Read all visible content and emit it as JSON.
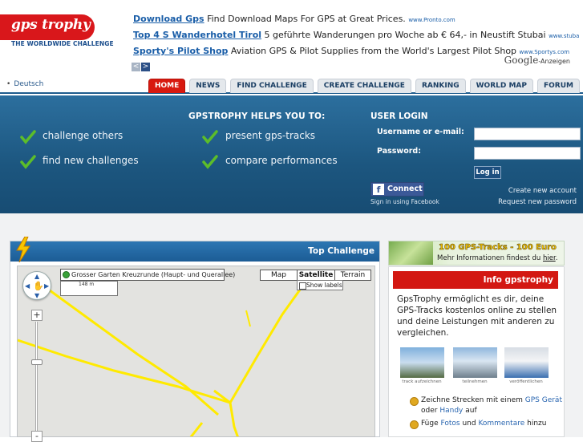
{
  "logo": {
    "name": "gps trophy",
    "tagline": "THE WORLDWIDE CHALLENGE"
  },
  "ads": [
    {
      "title": "Download Gps",
      "text": "Find Download Maps For GPS at Great Prices.",
      "url": "www.Pronto.com"
    },
    {
      "title": "Top 4 S Wanderhotel Tirol",
      "text": "5 geführte Wanderungen pro Woche ab € 64,- in Neustift Stubai",
      "url": "www.stubaierhof.eu/wand..."
    },
    {
      "title": "Sporty's Pilot Shop",
      "text": "Aviation GPS & Pilot Supplies from the World's Largest Pilot Shop",
      "url": "www.Sportys.com"
    }
  ],
  "ad_nav": {
    "prev": "<",
    "next": ">"
  },
  "google_ads": {
    "brand": "Google",
    "label": "-Anzeigen"
  },
  "nav": {
    "language": "Deutsch",
    "tabs": [
      "HOME",
      "NEWS",
      "FIND CHALLENGE",
      "CREATE CHALLENGE",
      "RANKING",
      "WORLD MAP",
      "FORUM"
    ]
  },
  "hero": {
    "heading": "GPSTROPHY HELPS YOU TO:",
    "features_left": [
      "challenge others",
      "find new challenges"
    ],
    "features_right": [
      "present gps-tracks",
      "compare performances"
    ],
    "check_color": "#5cbd2a"
  },
  "login": {
    "title": "USER LOGIN",
    "username_label": "Username or e-mail:",
    "password_label": "Password:",
    "button": "Log in",
    "fb_connect": "Connect",
    "fb_note": "Sign in using Facebook",
    "create_account": "Create new account",
    "request_password": "Request new password"
  },
  "challenge": {
    "title": "Top Challenge",
    "map_label": "Grosser Garten Kreuzrunde (Haupt- und Querallee)",
    "map_info_value": "148 m",
    "map_types": [
      "Map",
      "Satellite",
      "Terrain"
    ],
    "selected_map_type": "Satellite",
    "show_labels": "Show labels",
    "zoom_in": "+",
    "zoom_out": "-"
  },
  "banner": {
    "title": "100 GPS-Tracks - 100 Euro",
    "sub_prefix": "Mehr Informationen findest du ",
    "sub_link": "hier",
    "sub_suffix": "."
  },
  "info": {
    "title": "Info gpstrophy",
    "text": "GpsTrophy ermöglicht es dir, deine GPS-Tracks kostenlos online zu stellen und deine Leistungen mit anderen zu vergleichen.",
    "thumbs": [
      "track aufzeichnen",
      "teilnehmen",
      "veröffentlichen"
    ],
    "bullets": [
      {
        "a": "Zeichne Strecken mit einem ",
        "link1": "GPS Gerät",
        "b": " oder ",
        "link2": "Handy",
        "c": " auf"
      },
      {
        "a": "Füge ",
        "link1": "Fotos",
        "b": " und ",
        "link2": "Kommentare",
        "c": " hinzu"
      }
    ]
  },
  "colors": {
    "brand_red": "#d9171b",
    "hero_blue": "#1c567f",
    "track_yellow": "#ffea00"
  }
}
